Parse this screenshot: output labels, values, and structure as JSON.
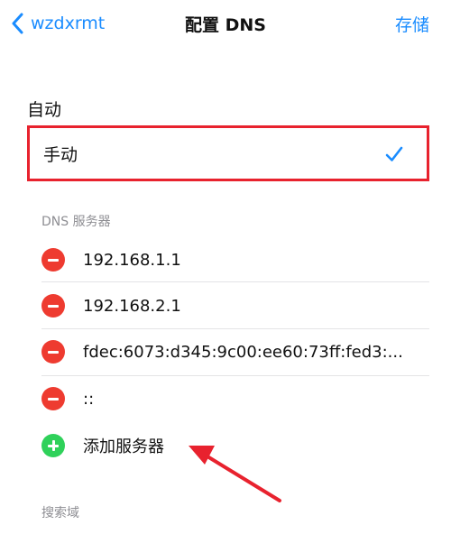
{
  "nav": {
    "back_label": "wzdxrmt",
    "title": "配置 DNS",
    "save_label": "存储"
  },
  "modes": {
    "auto_label": "自动",
    "manual_label": "手动",
    "selected": "手动"
  },
  "dns_section": {
    "header": "DNS 服务器",
    "servers": [
      "192.168.1.1",
      "192.168.2.1",
      "fdec:6073:d345:9c00:ee60:73ff:fed3:...",
      "::"
    ],
    "add_label": "添加服务器"
  },
  "search_section": {
    "header": "搜索域"
  },
  "colors": {
    "accent": "#1a8cff",
    "highlight_border": "#e8222e",
    "delete": "#ee3b30",
    "add": "#2fd15a",
    "section_header": "#8e8e93"
  },
  "icons": {
    "back": "chevron-left-icon",
    "check": "checkmark-icon",
    "delete": "minus-circle-icon",
    "add": "plus-circle-icon",
    "annotation": "arrow-icon"
  }
}
